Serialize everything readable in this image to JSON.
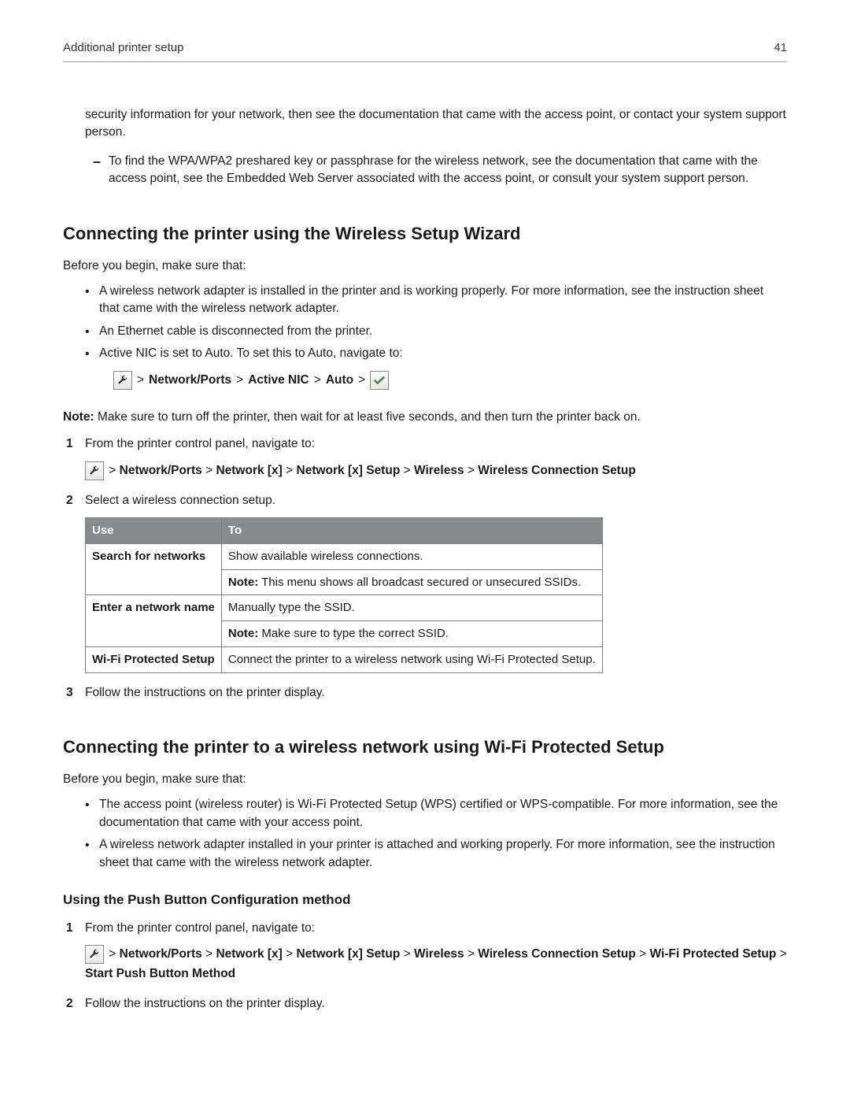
{
  "header": {
    "title": "Additional printer setup",
    "page_number": "41"
  },
  "intro_paragraph": "security information for your network, then see the documentation that came with the access point, or contact your system support person.",
  "dash_item": "To find the WPA/WPA2 preshared key or passphrase for the wireless network, see the documentation that came with the access point, see the Embedded Web Server associated with the access point, or consult your system support person.",
  "section1": {
    "heading": "Connecting the printer using the Wireless Setup Wizard",
    "before": "Before you begin, make sure that:",
    "bullets": [
      "A wireless network adapter is installed in the printer and is working properly. For more information, see the instruction sheet that came with the wireless network adapter.",
      "An Ethernet cable is disconnected from the printer.",
      "Active NIC is set to Auto. To set this to Auto, navigate to:"
    ],
    "nav1": {
      "parts": [
        "Network/Ports",
        "Active NIC",
        "Auto"
      ]
    },
    "note_label": "Note:",
    "note_text": " Make sure to turn off the printer, then wait for at least five seconds, and then turn the printer back on.",
    "steps": [
      {
        "num": "1",
        "text": "From the printer control panel, navigate to:",
        "nav": {
          "parts": [
            "Network/Ports",
            "Network [x]",
            "Network [x] Setup",
            "Wireless",
            "Wireless Connection Setup"
          ]
        }
      },
      {
        "num": "2",
        "text": "Select a wireless connection setup."
      },
      {
        "num": "3",
        "text": "Follow the instructions on the printer display."
      }
    ],
    "table": {
      "headers": [
        "Use",
        "To"
      ],
      "rows": [
        {
          "use": "Search for networks",
          "to_lines": [
            {
              "plain": "Show available wireless connections."
            },
            {
              "bold": "Note:",
              "rest": " This menu shows all broadcast secured or unsecured SSIDs."
            }
          ]
        },
        {
          "use": "Enter a network name",
          "to_lines": [
            {
              "plain": "Manually type the SSID."
            },
            {
              "bold": "Note:",
              "rest": " Make sure to type the correct SSID."
            }
          ]
        },
        {
          "use": "Wi-Fi Protected Setup",
          "to_lines": [
            {
              "plain": "Connect the printer to a wireless network using Wi-Fi Protected Setup."
            }
          ]
        }
      ]
    }
  },
  "section2": {
    "heading": "Connecting the printer to a wireless network using Wi-Fi Protected Setup",
    "before": "Before you begin, make sure that:",
    "bullets": [
      "The access point (wireless router) is Wi-Fi Protected Setup (WPS) certified or WPS-compatible. For more information, see the documentation that came with your access point.",
      "A wireless network adapter installed in your printer is attached and working properly. For more information, see the instruction sheet that came with the wireless network adapter."
    ],
    "subhead": "Using the Push Button Configuration method",
    "steps": [
      {
        "num": "1",
        "text": "From the printer control panel, navigate to:",
        "nav": {
          "parts": [
            "Network/Ports",
            "Network [x]",
            "Network [x] Setup",
            "Wireless",
            "Wireless Connection Setup",
            "Wi-Fi Protected Setup",
            "Start Push Button Method"
          ]
        }
      },
      {
        "num": "2",
        "text": "Follow the instructions on the printer display."
      }
    ]
  }
}
